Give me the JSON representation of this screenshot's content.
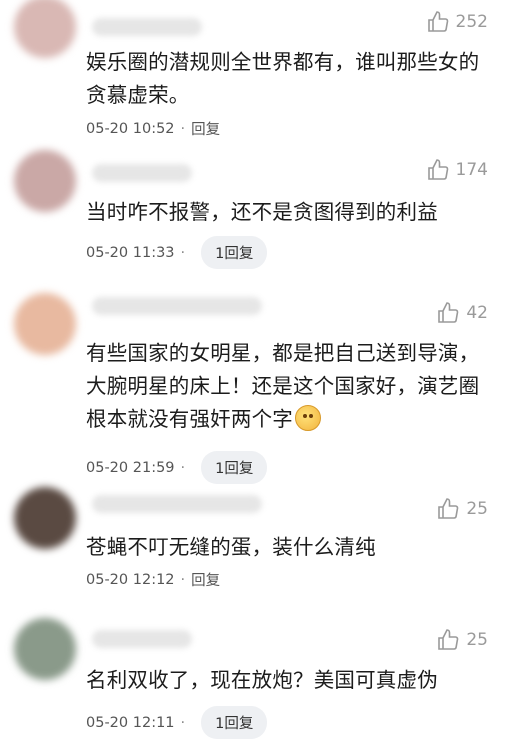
{
  "comments": [
    {
      "avatar_color": "#d9b8b4",
      "likes": "252",
      "text": "娱乐圈的潜规则全世界都有，谁叫那些女的贪慕虚荣。",
      "time": "05-20 10:52",
      "reply": "回复"
    },
    {
      "avatar_color": "#caa8a6",
      "likes": "174",
      "text": "当时咋不报警，还不是贪图得到的利益",
      "time": "05-20 11:33",
      "reply": "1回复"
    },
    {
      "avatar_color": "#e8b9a0",
      "likes": "42",
      "text": "有些国家的女明星，都是把自己送到导演，大腕明星的床上！还是这个国家好，演艺圈根本就没有强奸两个字",
      "emoji": "shocked-emoji",
      "time": "05-20 21:59",
      "reply": "1回复"
    },
    {
      "avatar_color": "#5a4a42",
      "likes": "25",
      "text": "苍蝇不叮无缝的蛋，装什么清纯",
      "time": "05-20 12:12",
      "reply": "回复"
    },
    {
      "avatar_color": "#8a9a8a",
      "likes": "25",
      "text": "名利双收了，现在放炮？美国可真虚伪",
      "time": "05-20 12:11",
      "reply": "1回复"
    }
  ],
  "dot": "·"
}
